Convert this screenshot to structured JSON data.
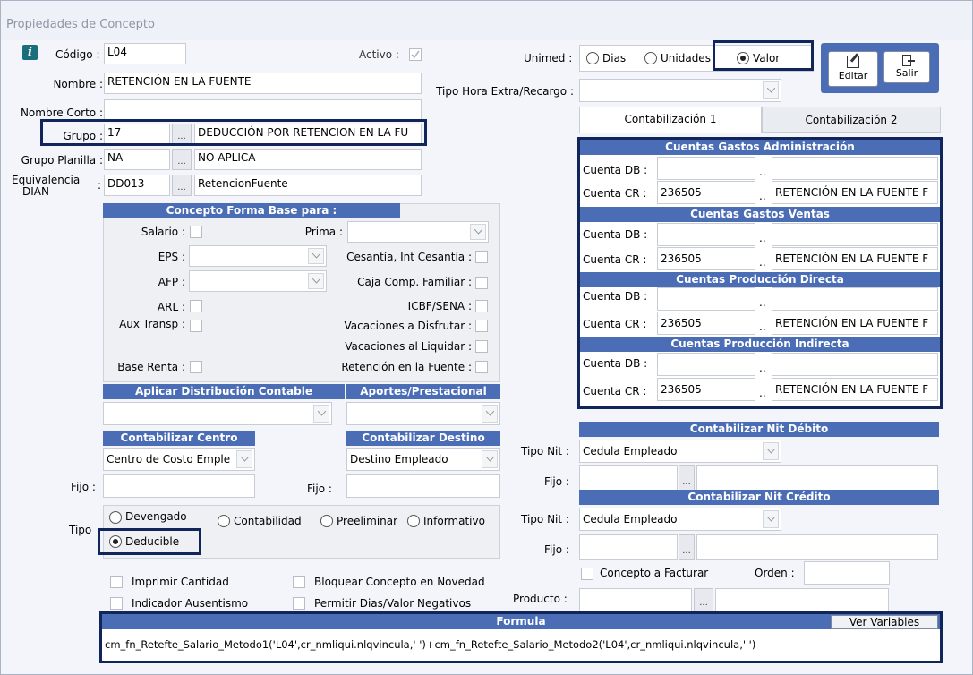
{
  "window": {
    "title": "Propiedades de Concepto"
  },
  "colors": {
    "header_blue": "#4a6db5",
    "highlight_border": "#10265a",
    "info_icon": "#1b6f7d"
  },
  "left": {
    "codigo_label": "Código :",
    "codigo": "L04",
    "activo_label": "Activo :",
    "nombre_label": "Nombre :",
    "nombre": "RETENCIÓN EN LA FUENTE",
    "nombre_corto_label": "Nombre Corto :",
    "nombre_corto": "",
    "grupo_label": "Grupo :",
    "grupo": "17",
    "grupo_desc": "DEDUCCIÓN POR RETENCION EN LA FU",
    "grupo_planilla_label": "Grupo Planilla :",
    "grupo_planilla": "NA",
    "grupo_planilla_desc": "NO APLICA",
    "equivalencia_label_1": "Equivalencia",
    "equivalencia_label_2": "DIAN",
    "equivalencia_colon": ":",
    "equivalencia": "DD013",
    "equivalencia_desc": "RetencionFuente"
  },
  "base": {
    "header": "Concepto Forma Base para :",
    "salario": "Salario :",
    "prima": "Prima :",
    "eps": "EPS :",
    "cesantia": "Cesantía, Int Cesantía :",
    "afp": "AFP :",
    "caja": "Caja Comp. Familiar :",
    "arl": "ARL :",
    "icbf": "ICBF/SENA :",
    "aux": "Aux Transp :",
    "vac_disf": "Vacaciones a Disfrutar :",
    "vac_liq": "Vacaciones al Liquidar :",
    "base_renta": "Base Renta :",
    "retencion": "Retención en la Fuente :"
  },
  "distrib": {
    "header": "Aplicar Distribución Contable",
    "aportes_header": "Aportes/Prestacional"
  },
  "centro": {
    "header": "Contabilizar Centro",
    "value": "Centro de Costo Emple",
    "fijo_label": "Fijo :"
  },
  "destino": {
    "header": "Contabilizar Destino",
    "value": "Destino Empleado",
    "fijo_label": "Fijo :"
  },
  "tipo": {
    "label": "Tipo",
    "devengado": "Devengado",
    "contabilidad": "Contabilidad",
    "preeliminar": "Preeliminar",
    "informativo": "Informativo",
    "deducible": "Deducible"
  },
  "flags": {
    "imprimir": "Imprimir Cantidad",
    "bloquear": "Bloquear Concepto en Novedad",
    "ausentismo": "Indicador Ausentismo",
    "negativos": "Permitir Dias/Valor Negativos"
  },
  "right": {
    "unimed_label": "Unimed :",
    "dias": "Dias",
    "unidades": "Unidades",
    "valor": "Valor",
    "tipo_hora_label": "Tipo Hora Extra/Recargo :",
    "editar": "Editar",
    "salir": "Salir",
    "tab1": "Contabilización 1",
    "tab2": "Contabilización 2"
  },
  "cuentas": {
    "db_label": "Cuenta DB :",
    "cr_label": "Cuenta CR :",
    "sections": [
      {
        "header": "Cuentas Gastos Administración",
        "cr": "236505",
        "cr_desc": "RETENCIÓN EN LA FUENTE F"
      },
      {
        "header": "Cuentas Gastos Ventas",
        "cr": "236505",
        "cr_desc": "RETENCIÓN EN LA FUENTE F"
      },
      {
        "header": "Cuentas Producción Directa",
        "cr": "236505",
        "cr_desc": "RETENCIÓN EN LA FUENTE F"
      },
      {
        "header": "Cuentas Producción Indirecta",
        "cr": "236505",
        "cr_desc": "RETENCIÓN EN LA FUENTE F"
      }
    ]
  },
  "nit": {
    "debito_header": "Contabilizar Nit Débito",
    "credito_header": "Contabilizar Nit Crédito",
    "tipo_label": "Tipo Nit :",
    "fijo_label": "Fijo :",
    "debito_tipo": "Cedula Empleado",
    "credito_tipo": "Cedula Empleado"
  },
  "facturar": {
    "label": "Concepto a Facturar",
    "orden_label": "Orden :",
    "producto_label": "Producto :"
  },
  "formula": {
    "header": "Formula",
    "ver_variables": "Ver Variables",
    "text": "cm_fn_Retefte_Salario_Metodo1('L04',cr_nmliqui.nlqvincula,' ')+cm_fn_Retefte_Salario_Metodo2('L04',cr_nmliqui.nlqvincula,' ')"
  }
}
